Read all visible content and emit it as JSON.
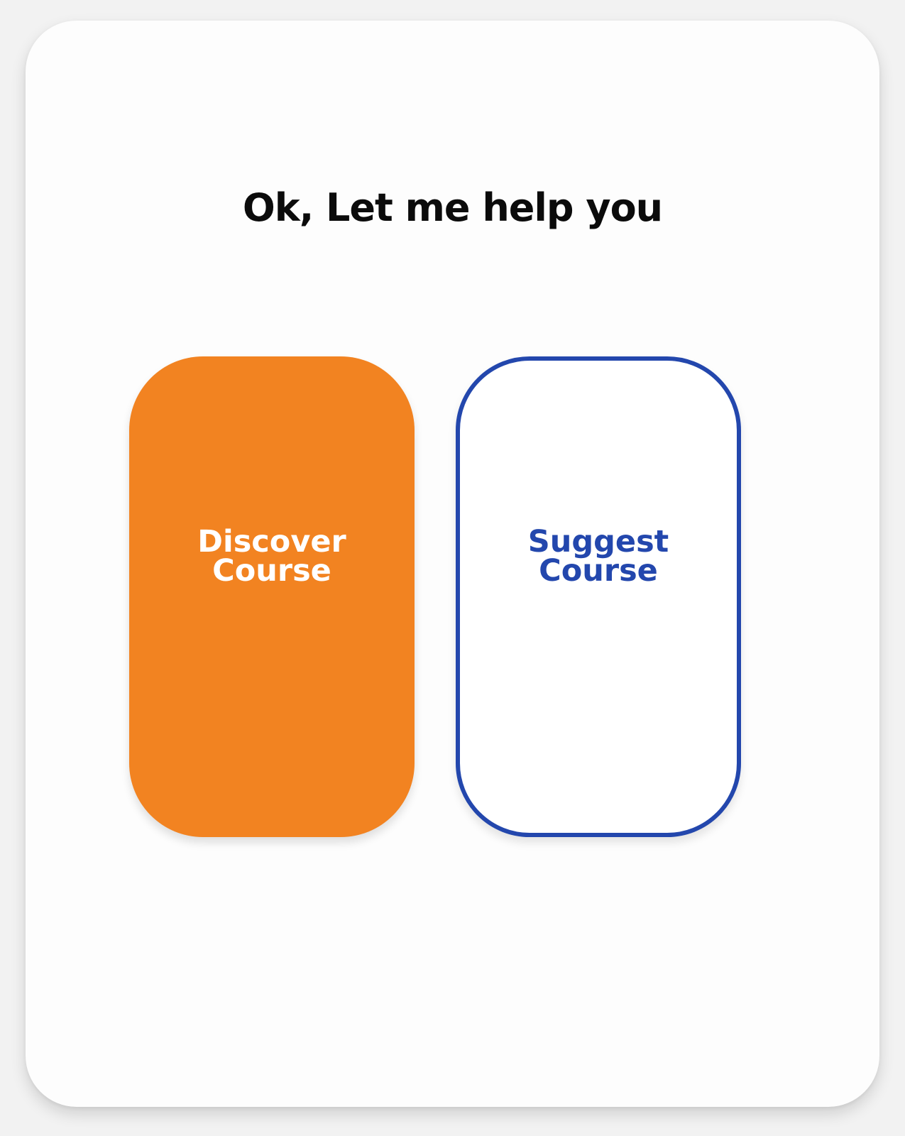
{
  "prompt": {
    "title": "Ok, Let me help you"
  },
  "options": [
    {
      "line1": "Discover",
      "line2": "Course",
      "color": "#f28321",
      "style": "filled"
    },
    {
      "line1": "Suggest",
      "line2": "Course",
      "color": "#2347ad",
      "style": "outlined"
    }
  ]
}
